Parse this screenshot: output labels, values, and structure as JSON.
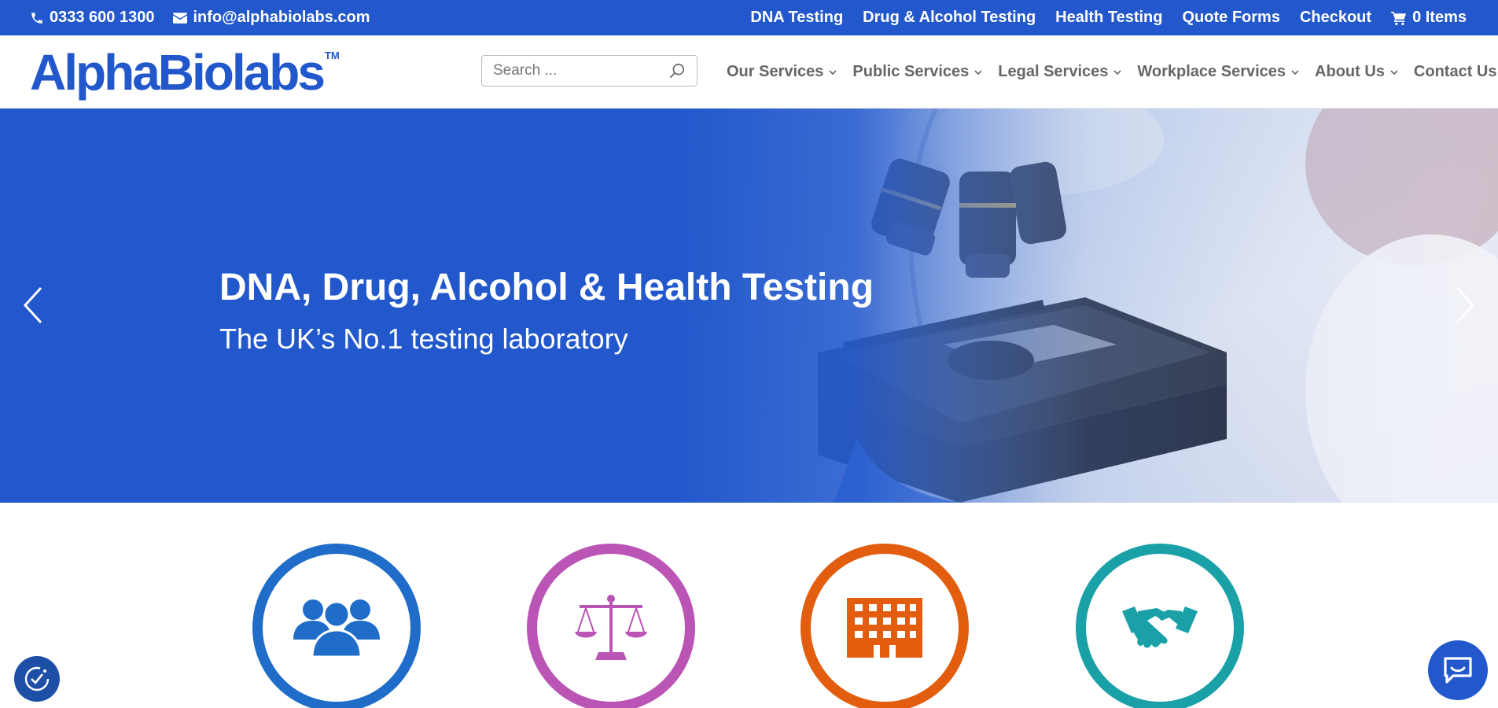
{
  "topbar": {
    "phone": "0333 600 1300",
    "email": "info@alphabiolabs.com",
    "links": [
      "DNA Testing",
      "Drug & Alcohol Testing",
      "Health Testing",
      "Quote Forms",
      "Checkout"
    ],
    "cart_label": "0 Items"
  },
  "header": {
    "logo_text": "AlphaBiolabs",
    "logo_tm": "TM",
    "search_placeholder": "Search ...",
    "nav": [
      "Our Services",
      "Public Services",
      "Legal Services",
      "Workplace Services",
      "About Us",
      "Contact Us"
    ]
  },
  "hero": {
    "title": "DNA, Drug, Alcohol & Health Testing",
    "subtitle": "The UK’s No.1 testing laboratory"
  },
  "services": [
    {
      "icon": "people-icon",
      "color": "#1f6cc9"
    },
    {
      "icon": "scales-icon",
      "color": "#bb55b5"
    },
    {
      "icon": "building-icon",
      "color": "#e35d0f"
    },
    {
      "icon": "handshake-icon",
      "color": "#1aa1a8"
    }
  ],
  "colors": {
    "brand_blue": "#2258cc",
    "nav_gray": "#666666"
  }
}
